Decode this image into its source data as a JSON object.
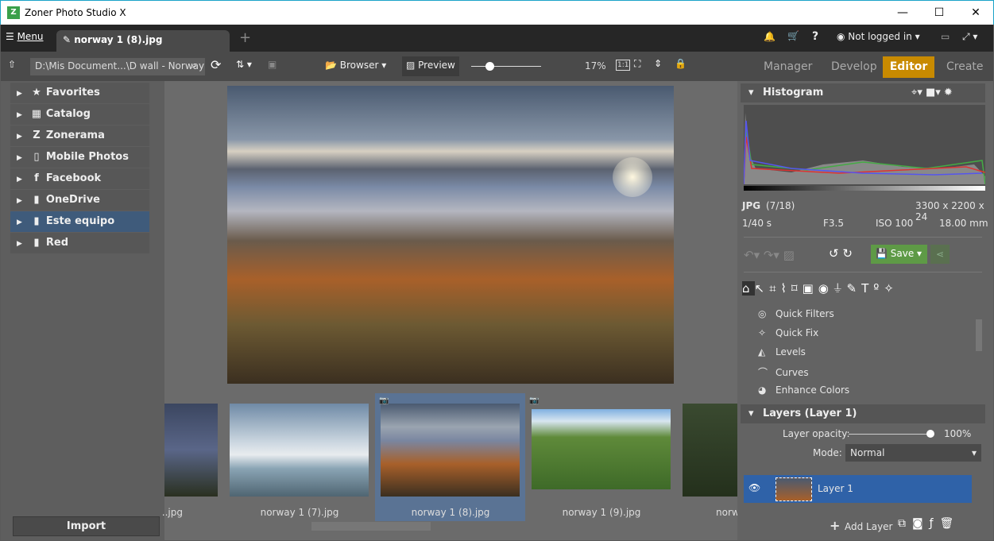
{
  "app": {
    "title": "Zoner Photo Studio X",
    "logo": "Z"
  },
  "tabbar": {
    "menu": "Menu",
    "tab": "norway 1 (8).jpg",
    "add": "+",
    "user": "Not logged in",
    "icons": [
      "bell-icon",
      "cart-icon",
      "help-icon",
      "user-icon",
      "monitor-icon",
      "fullscreen-icon"
    ]
  },
  "toolbar": {
    "path": "D:\\Mis Document...\\D wall - Norway",
    "browser": "Browser",
    "preview": "Preview",
    "zoom": "17%",
    "zoom_slider_fraction": 0.2,
    "one_to_one": "1:1",
    "modes": [
      "Manager",
      "Develop",
      "Editor",
      "Create"
    ],
    "active_mode": "Editor",
    "accent": "#c88a00"
  },
  "left": {
    "items": [
      {
        "label": "Favorites",
        "icon": "★"
      },
      {
        "label": "Catalog",
        "icon": "▦"
      },
      {
        "label": "Zonerama",
        "icon": "Z"
      },
      {
        "label": "Mobile Photos",
        "icon": "▯"
      },
      {
        "label": "Facebook",
        "icon": "f"
      },
      {
        "label": "OneDrive",
        "icon": "▮"
      },
      {
        "label": "Este equipo",
        "icon": "▮"
      },
      {
        "label": "Red",
        "icon": "▮"
      }
    ],
    "selected": "Este equipo",
    "import": "Import"
  },
  "filmstrip": {
    "items": [
      "..jpg",
      "norway 1 (7).jpg",
      "norway 1 (8).jpg",
      "norway 1 (9).jpg",
      "norw"
    ],
    "selected": "norway 1 (8).jpg"
  },
  "right": {
    "histogram": "Histogram",
    "format": "JPG",
    "index": "(7/18)",
    "dims": "3300 x 2200 x 24",
    "shutter": "1/40 s",
    "aperture": "F3.5",
    "iso": "ISO 100",
    "focal": "18.00 mm",
    "save": "Save",
    "tools": [
      "Quick Filters",
      "Quick Fix",
      "Levels",
      "Curves",
      "Enhance Colors"
    ],
    "layers": "Layers (Layer 1)",
    "opacity_label": "Layer opacity:",
    "opacity": "100%",
    "mode_label": "Mode:",
    "mode": "Normal",
    "layer": "Layer 1",
    "add_layer": "Add Layer",
    "save_color": "#5e9a46",
    "selected_layer_color": "#2f62a8"
  }
}
